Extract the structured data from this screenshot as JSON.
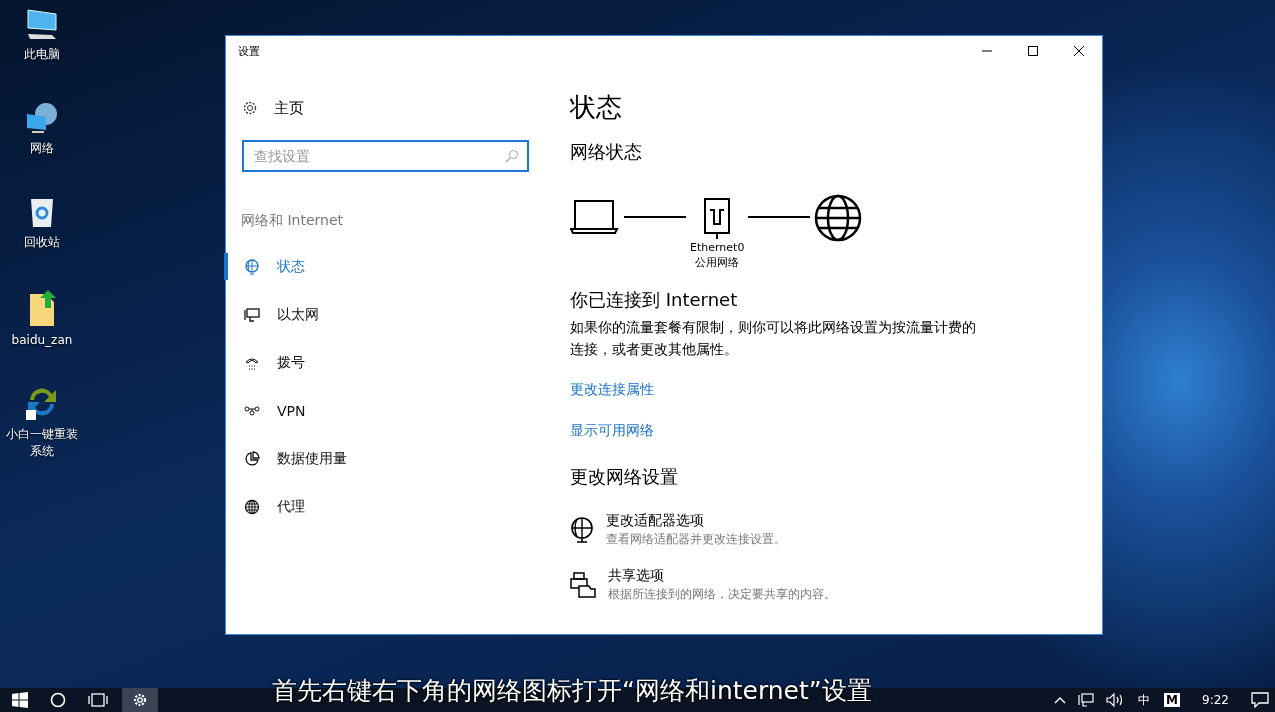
{
  "desktop_icons": [
    {
      "label": "此电脑"
    },
    {
      "label": "网络"
    },
    {
      "label": "回收站"
    },
    {
      "label": "baidu_zan"
    },
    {
      "label": "小白一键重装系统"
    }
  ],
  "window": {
    "title": "设置"
  },
  "nav": {
    "home": "主页",
    "search": {
      "placeholder": "查找设置"
    },
    "section": "网络和 Internet",
    "items": [
      {
        "label": "状态",
        "selected": true
      },
      {
        "label": "以太网",
        "selected": false
      },
      {
        "label": "拨号",
        "selected": false
      },
      {
        "label": "VPN",
        "selected": false
      },
      {
        "label": "数据使用量",
        "selected": false
      },
      {
        "label": "代理",
        "selected": false
      }
    ]
  },
  "content": {
    "title": "状态",
    "network_status": "网络状态",
    "adapter": "Ethernet0",
    "network_type": "公用网络",
    "connected": "你已连接到 Internet",
    "description": "如果你的流量套餐有限制，则你可以将此网络设置为按流量计费的连接，或者更改其他属性。",
    "links": [
      "更改连接属性",
      "显示可用网络"
    ],
    "change_settings": "更改网络设置",
    "options": [
      {
        "title": "更改适配器选项",
        "description": "查看网络适配器并更改连接设置。"
      },
      {
        "title": "共享选项",
        "description": "根据所连接到的网络，决定要共享的内容。"
      }
    ]
  },
  "caption": "首先右键右下角的网络图标打开“网络和internet”设置",
  "taskbar": {
    "ime": "中",
    "ime_mode": "M",
    "time": "9:22"
  }
}
